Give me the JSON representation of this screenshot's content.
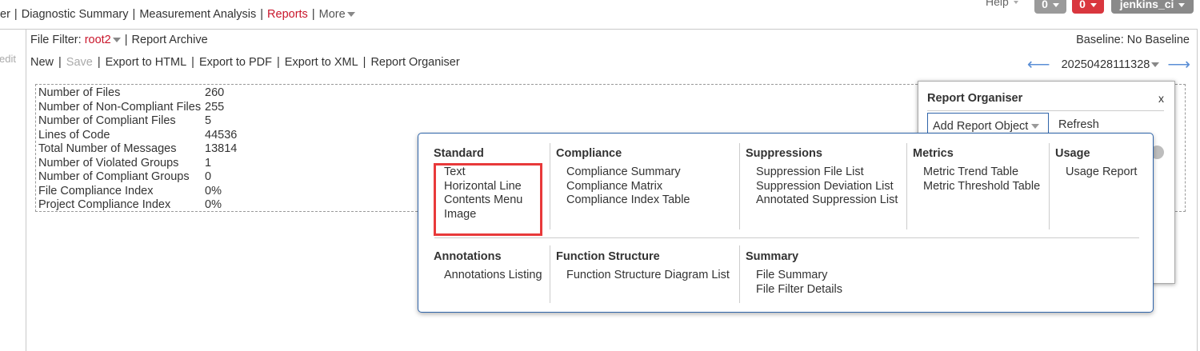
{
  "nav": {
    "items": [
      "er",
      "Diagnostic Summary",
      "Measurement Analysis",
      "Reports"
    ],
    "more": "More",
    "help": "Help",
    "btn_gray": "0",
    "btn_red": "0",
    "user": "jenkins_ci"
  },
  "left": {
    "edit": "edit"
  },
  "toolbar": {
    "file_filter_label": "File Filter:",
    "file_filter_value": "root2",
    "report_archive": "Report Archive",
    "baseline": "Baseline: No Baseline",
    "new": "New",
    "save": "Save",
    "export_html": "Export to HTML",
    "export_pdf": "Export to PDF",
    "export_xml": "Export to XML",
    "report_organiser": "Report Organiser",
    "snapshot": "20250428111328"
  },
  "stats": [
    {
      "k": "Number of Files",
      "v": "260"
    },
    {
      "k": "Number of Non-Compliant Files",
      "v": "255"
    },
    {
      "k": "Number of Compliant Files",
      "v": "5"
    },
    {
      "k": "Lines of Code",
      "v": "44536"
    },
    {
      "k": "Total Number of Messages",
      "v": "13814"
    },
    {
      "k": "Number of Violated Groups",
      "v": "1"
    },
    {
      "k": "Number of Compliant Groups",
      "v": "0"
    },
    {
      "k": "File Compliance Index",
      "v": "0%"
    },
    {
      "k": "Project Compliance Index",
      "v": "0%"
    }
  ],
  "organiser": {
    "title": "Report Organiser",
    "close": "x",
    "add": "Add Report Object",
    "refresh": "Refresh"
  },
  "menu": {
    "standard": {
      "title": "Standard",
      "items": [
        "Text",
        "Horizontal Line",
        "Contents Menu",
        "Image"
      ]
    },
    "compliance": {
      "title": "Compliance",
      "items": [
        "Compliance Summary",
        "Compliance Matrix",
        "Compliance Index Table"
      ]
    },
    "suppressions": {
      "title": "Suppressions",
      "items": [
        "Suppression File List",
        "Suppression Deviation List",
        "Annotated Suppression List"
      ]
    },
    "metrics": {
      "title": "Metrics",
      "items": [
        "Metric Trend Table",
        "Metric Threshold Table"
      ]
    },
    "usage": {
      "title": "Usage",
      "items": [
        "Usage Report"
      ]
    },
    "annotations": {
      "title": "Annotations",
      "items": [
        "Annotations Listing"
      ]
    },
    "function_structure": {
      "title": "Function Structure",
      "items": [
        "Function Structure Diagram List"
      ]
    },
    "summary": {
      "title": "Summary",
      "items": [
        "File Summary",
        "File Filter Details"
      ]
    }
  },
  "colors": {
    "accent_red": "#c9162b",
    "highlight": "#e8393a",
    "link_blue": "#2f64a9"
  }
}
